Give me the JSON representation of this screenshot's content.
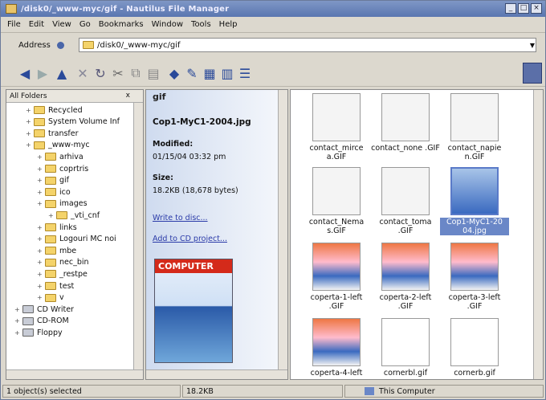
{
  "window": {
    "title": "/disk0/_www-myc/gif - Nautilus File Manager"
  },
  "menu": [
    "File",
    "Edit",
    "View",
    "Go",
    "Bookmarks",
    "Window",
    "Tools",
    "Help"
  ],
  "address": {
    "label": "Address",
    "value": "/disk0/_www-myc/gif"
  },
  "left_pane": {
    "header": "All Folders",
    "close": "x",
    "tree": [
      {
        "label": "Recycled",
        "depth": 2
      },
      {
        "label": "System Volume Inf",
        "depth": 2
      },
      {
        "label": "transfer",
        "depth": 2
      },
      {
        "label": "_www-myc",
        "depth": 2
      },
      {
        "label": "arhiva",
        "depth": 3
      },
      {
        "label": "coprtris",
        "depth": 3
      },
      {
        "label": "gif",
        "depth": 3
      },
      {
        "label": "ico",
        "depth": 3
      },
      {
        "label": "images",
        "depth": 3
      },
      {
        "label": "_vti_cnf",
        "depth": 4
      },
      {
        "label": "links",
        "depth": 3
      },
      {
        "label": "Logouri MC noi",
        "depth": 3
      },
      {
        "label": "mbe",
        "depth": 3
      },
      {
        "label": "nec_bin",
        "depth": 3
      },
      {
        "label": "_restpe",
        "depth": 3
      },
      {
        "label": "test",
        "depth": 3
      },
      {
        "label": "v",
        "depth": 3
      },
      {
        "label": "CD Writer",
        "depth": 1
      },
      {
        "label": "CD-ROM",
        "depth": 1
      },
      {
        "label": "Floppy",
        "depth": 1
      }
    ]
  },
  "mid_pane": {
    "title": "gif",
    "close": "x",
    "filename": "Cop1-MyC1-2004.jpg",
    "modified_label": "Modified:",
    "modified_value": "01/15/04 03:32 pm",
    "size_label": "Size:",
    "size_value": "18.2KB (18,678 bytes)",
    "link1": "Write to disc...",
    "link2": "Add to CD project...",
    "cover_text": "COMPUTER"
  },
  "files": [
    {
      "label": "contact_mirce a.GIF"
    },
    {
      "label": "contact_none .GIF"
    },
    {
      "label": "contact_napie n.GIF"
    },
    {
      "label": "contact_Nema s.GIF"
    },
    {
      "label": "contact_toma .GIF"
    },
    {
      "label": "Cop1-MyC1-20 04.jpg",
      "selected": true
    },
    {
      "label": "coperta-1-left .GIF"
    },
    {
      "label": "coperta-2-left .GIF"
    },
    {
      "label": "coperta-3-left .GIF"
    },
    {
      "label": "coperta-4-left"
    },
    {
      "label": "cornerbl.gif"
    },
    {
      "label": "cornerb.gif"
    }
  ],
  "status": {
    "selected": "1 object(s) selected",
    "size": "18.2KB",
    "zone": "This Computer"
  },
  "colors": {
    "title_bar": "#5a76b0",
    "selection": "#6a87c7",
    "link": "#2a3aa8"
  }
}
